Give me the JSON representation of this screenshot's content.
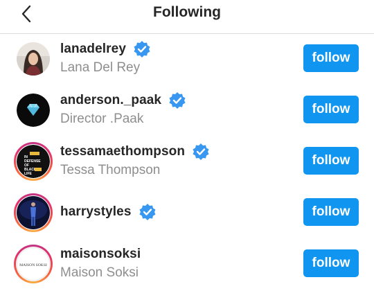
{
  "header": {
    "title": "Following",
    "back_icon": "chevron-left-icon"
  },
  "accent_color": "#1095f0",
  "follow_label": "follow",
  "users": [
    {
      "username": "lanadelrey",
      "full_name": "Lana Del Rey",
      "verified": true,
      "story_ring": false
    },
    {
      "username": "anderson._paak",
      "full_name": "Director .Paak",
      "verified": true,
      "story_ring": false
    },
    {
      "username": "tessamaethompson",
      "full_name": "Tessa Thompson",
      "verified": true,
      "story_ring": true,
      "avatar_text": [
        "IN",
        "DEFENSE",
        "OF",
        "BLACK",
        "LIFE"
      ]
    },
    {
      "username": "harrystyles",
      "full_name": "",
      "verified": true,
      "story_ring": true
    },
    {
      "username": "maisonsoksi",
      "full_name": "Maison Soksi",
      "verified": false,
      "story_ring": true,
      "avatar_text": [
        "MAISON SOKSI"
      ]
    }
  ]
}
